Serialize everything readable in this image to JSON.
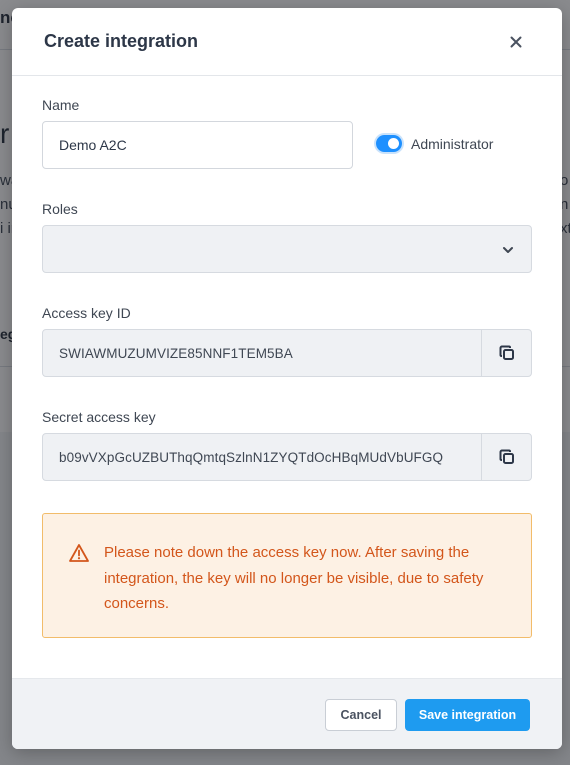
{
  "modal": {
    "title": "Create integration",
    "close_icon": "close-icon"
  },
  "form": {
    "name_label": "Name",
    "name_value": "Demo A2C",
    "administrator_label": "Administrator",
    "administrator_enabled": true,
    "roles_label": "Roles",
    "roles_selected": "",
    "access_key_label": "Access key ID",
    "access_key_value": "SWIAWMUZUMVIZE85NNF1TEM5BA",
    "secret_key_label": "Secret access key",
    "secret_key_value": "b09vVXpGcUZBUThqQmtqSzlnN1ZYQTdOcHBqMUdVbUFGQ"
  },
  "warning": {
    "icon": "warning-triangle-icon",
    "text": "Please note down the access key now. After saving the integration, the key will no longer be visible, due to safety concerns."
  },
  "footer": {
    "cancel_label": "Cancel",
    "save_label": "Save integration"
  },
  "colors": {
    "primary": "#1e9bf0",
    "toggle_on": "#1e90ff",
    "warning_text": "#d3561b",
    "warning_bg": "#fdf1e4",
    "warning_border": "#f2bc6a"
  }
}
